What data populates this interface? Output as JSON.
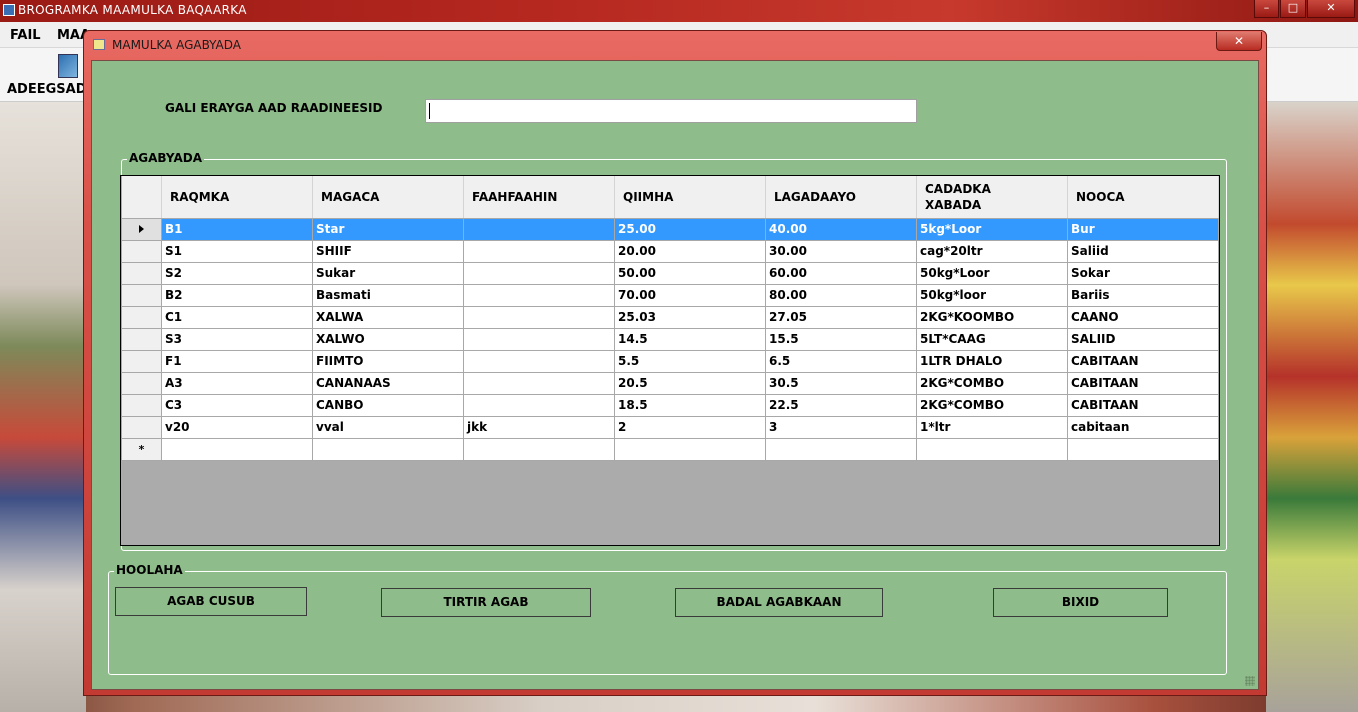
{
  "main_window": {
    "title": "BROGRAMKA  MAAMULKA BAQAARKA",
    "menu": [
      "FAIL",
      "MAA"
    ],
    "toolbar_label": "ADEEGSADE",
    "controls": [
      "–",
      "□",
      "✕"
    ]
  },
  "dialog": {
    "title": "MAMULKA AGABYADA",
    "close": "✕",
    "search_label": "GALI ERAYGA AAD RAADINEESID",
    "search_value": "",
    "group_items_label": "AGABYADA",
    "group_tools_label": "HOOLAHA",
    "columns": [
      "RAQMKA",
      "MAGACA",
      "FAAHFAAHIN",
      "QIIMHA",
      "LAGADAAYO",
      "CADADKA\nXABADA",
      "NOOCA"
    ],
    "rows": [
      [
        "B1",
        "Star",
        "",
        "25.00",
        "40.00",
        "5kg*Loor",
        "Bur"
      ],
      [
        "S1",
        "SHIIF",
        "",
        "20.00",
        "30.00",
        "cag*20ltr",
        "Saliid"
      ],
      [
        "S2",
        "Sukar",
        "",
        "50.00",
        "60.00",
        "50kg*Loor",
        "Sokar"
      ],
      [
        "B2",
        "Basmati",
        "",
        "70.00",
        "80.00",
        "50kg*loor",
        "Bariis"
      ],
      [
        "C1",
        "XALWA",
        "",
        "25.03",
        "27.05",
        "2KG*KOOMBO",
        "CAANO"
      ],
      [
        "S3",
        "XALWO",
        "",
        "14.5",
        "15.5",
        "5LT*CAAG",
        "SALIID"
      ],
      [
        "F1",
        "FIIMTO",
        "",
        "5.5",
        "6.5",
        "1LTR DHALO",
        "CABITAAN"
      ],
      [
        "A3",
        "CANANAAS",
        "",
        "20.5",
        "30.5",
        "2KG*COMBO",
        "CABITAAN"
      ],
      [
        "C3",
        "CANBO",
        "",
        "18.5",
        "22.5",
        "2KG*COMBO",
        "CABITAAN"
      ],
      [
        "v20",
        "vval",
        "jkk",
        "2",
        "3",
        "1*ltr",
        "cabitaan"
      ]
    ],
    "new_row_marker": "*",
    "buttons": {
      "new": "AGAB CUSUB",
      "delete": "TIRTIR AGAB",
      "edit": "BADAL  AGABKAAN",
      "exit": "BIXID"
    }
  },
  "colors": {
    "client_bg": "#8fbc8b",
    "selection": "#3399ff",
    "titlebar": "#d85048"
  }
}
